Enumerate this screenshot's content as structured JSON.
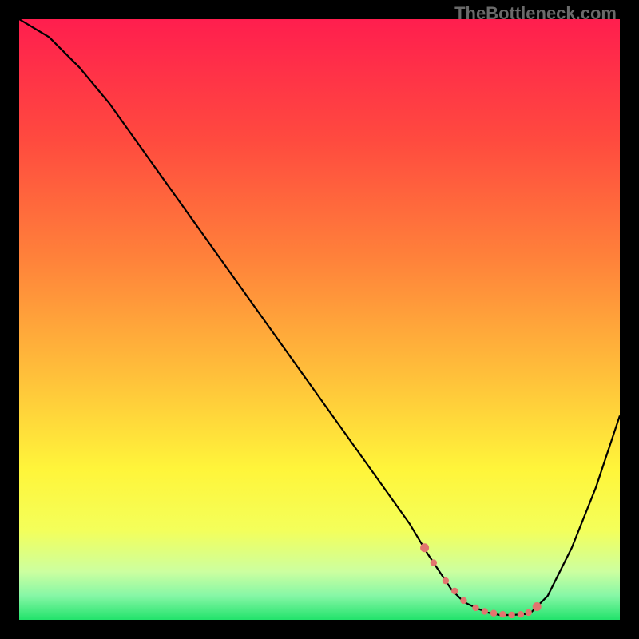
{
  "watermark": "TheBottleneck.com",
  "colors": {
    "background": "#000000",
    "curve_stroke": "#000000",
    "dot_fill": "#e2766f",
    "gradient_stops": [
      {
        "offset": 0.0,
        "color": "#ff1e4e"
      },
      {
        "offset": 0.2,
        "color": "#ff4a3f"
      },
      {
        "offset": 0.4,
        "color": "#ff823a"
      },
      {
        "offset": 0.6,
        "color": "#ffc23a"
      },
      {
        "offset": 0.75,
        "color": "#fff53a"
      },
      {
        "offset": 0.85,
        "color": "#f4ff5a"
      },
      {
        "offset": 0.92,
        "color": "#ccffa0"
      },
      {
        "offset": 0.96,
        "color": "#86f7a6"
      },
      {
        "offset": 1.0,
        "color": "#22e36b"
      }
    ]
  },
  "chart_data": {
    "type": "line",
    "title": "",
    "xlabel": "",
    "ylabel": "",
    "xlim": [
      0,
      100
    ],
    "ylim": [
      0,
      100
    ],
    "series": [
      {
        "name": "bottleneck_curve",
        "x": [
          0,
          5,
          10,
          15,
          20,
          25,
          30,
          35,
          40,
          45,
          50,
          55,
          60,
          65,
          68,
          70,
          72,
          74,
          76,
          78,
          80,
          82,
          85,
          88,
          92,
          96,
          100
        ],
        "y": [
          100,
          97,
          92,
          86,
          79,
          72,
          65,
          58,
          51,
          44,
          37,
          30,
          23,
          16,
          11,
          8,
          5,
          3,
          2,
          1.2,
          0.8,
          0.8,
          1.0,
          4,
          12,
          22,
          34
        ]
      }
    ],
    "highlight_points": {
      "name": "optimal_range_markers",
      "x": [
        67.5,
        69,
        71,
        72.5,
        74,
        76,
        77.5,
        79,
        80.5,
        82,
        83.5,
        84.8,
        86.2
      ],
      "y": [
        12,
        9.5,
        6.5,
        4.8,
        3.2,
        2.0,
        1.4,
        1.1,
        0.9,
        0.8,
        0.9,
        1.2,
        2.2
      ]
    },
    "legend": [],
    "grid": false
  }
}
